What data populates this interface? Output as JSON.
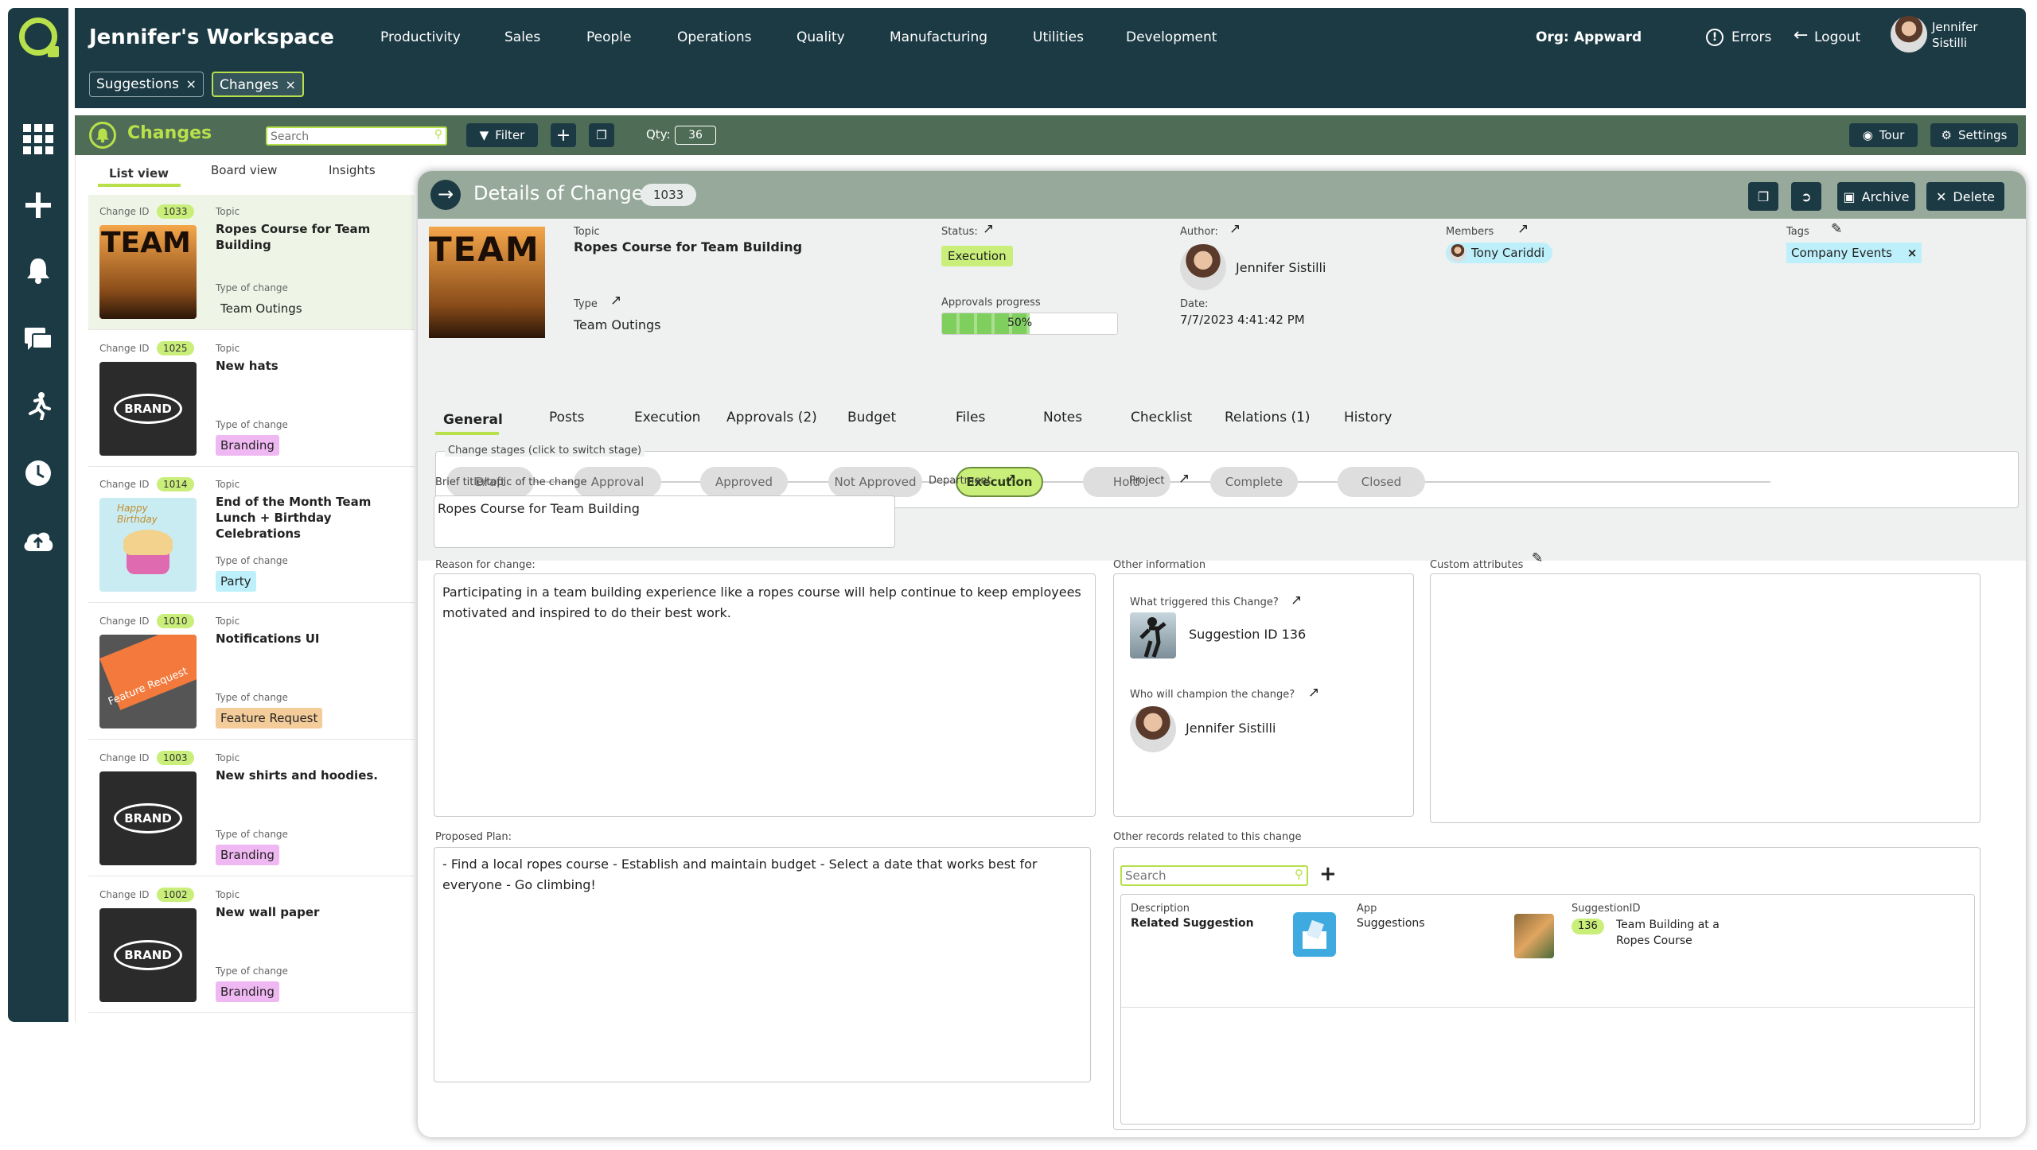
{
  "workspace_title": "Jennifer's Workspace",
  "nav": [
    "Productivity",
    "Sales",
    "People",
    "Operations",
    "Quality",
    "Manufacturing",
    "Utilities",
    "Development"
  ],
  "org_label": "Org:",
  "org_value": "Appward",
  "errors_label": "Errors",
  "logout_label": "Logout",
  "user_name_line1": "Jennifer",
  "user_name_line2": "Sistilli",
  "open_tabs": [
    {
      "label": "Suggestions",
      "close": "×"
    },
    {
      "label": "Changes",
      "close": "×"
    }
  ],
  "subbar": {
    "app_title": "Changes",
    "search_placeholder": "Search",
    "filter_label": "Filter",
    "qty_label": "Qty:",
    "qty_value": "36",
    "tour_label": "Tour",
    "settings_label": "Settings"
  },
  "view_tabs": [
    "List view",
    "Board view",
    "Insights"
  ],
  "list_labels": {
    "change_id": "Change ID",
    "topic": "Topic",
    "type_of_change": "Type of change"
  },
  "list_items": [
    {
      "id": "1033",
      "topic": "Ropes Course for Team Building",
      "type": "Team Outings",
      "type_color": "transparent",
      "thumb": "team"
    },
    {
      "id": "1025",
      "topic": "New hats",
      "type": "Branding",
      "type_color": "#f0b8f2",
      "thumb": "brand"
    },
    {
      "id": "1014",
      "topic": "End of the Month Team Lunch + Birthday Celebrations",
      "type": "Party",
      "type_color": "#bdf0fb",
      "thumb": "cupcake"
    },
    {
      "id": "1010",
      "topic": "Notifications UI",
      "type": "Feature Request",
      "type_color": "#f3cc9a",
      "thumb": "feature"
    },
    {
      "id": "1003",
      "topic": "New shirts and hoodies.",
      "type": "Branding",
      "type_color": "#f0b8f2",
      "thumb": "brand"
    },
    {
      "id": "1002",
      "topic": "New wall paper",
      "type": "Branding",
      "type_color": "#f0b8f2",
      "thumb": "brand"
    }
  ],
  "thumb_text": {
    "team": "TEAM",
    "brand": "BRAND",
    "feature": "Feature Request",
    "cupcake": "Happy Birthday"
  },
  "detail": {
    "title": "Details of Change",
    "id": "1033",
    "archive_label": "Archive",
    "delete_label": "Delete",
    "topic_label": "Topic",
    "topic_value": "Ropes Course for Team Building",
    "type_label": "Type",
    "type_value": "Team Outings",
    "status_label": "Status:",
    "status_value": "Execution",
    "approvals_label": "Approvals progress",
    "approvals_value": "50%",
    "approvals_fraction": 0.5,
    "author_label": "Author:",
    "author_value": "Jennifer Sistilli",
    "date_label": "Date:",
    "date_value": "7/7/2023 4:41:42 PM",
    "members_label": "Members",
    "member_value": "Tony Cariddi",
    "tags_label": "Tags",
    "tag_value": "Company Events",
    "tag_close": "×",
    "tabs": [
      "General",
      "Posts",
      "Execution",
      "Approvals (2)",
      "Budget",
      "Files",
      "Notes",
      "Checklist",
      "Relations (1)",
      "History"
    ],
    "stages_label": "Change stages (click to switch stage)",
    "stages": [
      "Draft",
      "Approval",
      "Approved",
      "Not Approved",
      "Execution",
      "Hold",
      "Complete",
      "Closed"
    ],
    "brief_label": "Brief title/topic of the change",
    "brief_value": "Ropes Course for Team Building",
    "department_label": "Department",
    "project_label": "Project",
    "reason_label": "Reason for change:",
    "reason_value": "Participating in a team building experience like a ropes course will help continue to keep employees motivated and inspired to do their best work.",
    "other_info_label": "Other information",
    "triggered_label": "What triggered this Change?",
    "triggered_value": "Suggestion ID 136",
    "champion_label": "Who will champion the change?",
    "champion_value": "Jennifer Sistilli",
    "custom_attr_label": "Custom attributes",
    "plan_label": "Proposed Plan:",
    "plan_value": "- Find a local ropes course - Establish and maintain budget - Select a date that works best for everyone - Go climbing!",
    "related_label": "Other records related to this change",
    "related_search_placeholder": "Search",
    "related": {
      "desc_label": "Description",
      "desc_value": "Related Suggestion",
      "app_label": "App",
      "app_value": "Suggestions",
      "sid_label": "SuggestionID",
      "sid_value": "136",
      "sid_title": "Team Building at a Ropes Course"
    }
  },
  "colors": {
    "dark": "#1c3a44",
    "green_bar": "#4f6d56",
    "accent": "#b7e04b",
    "badge": "#c9ee7a"
  }
}
